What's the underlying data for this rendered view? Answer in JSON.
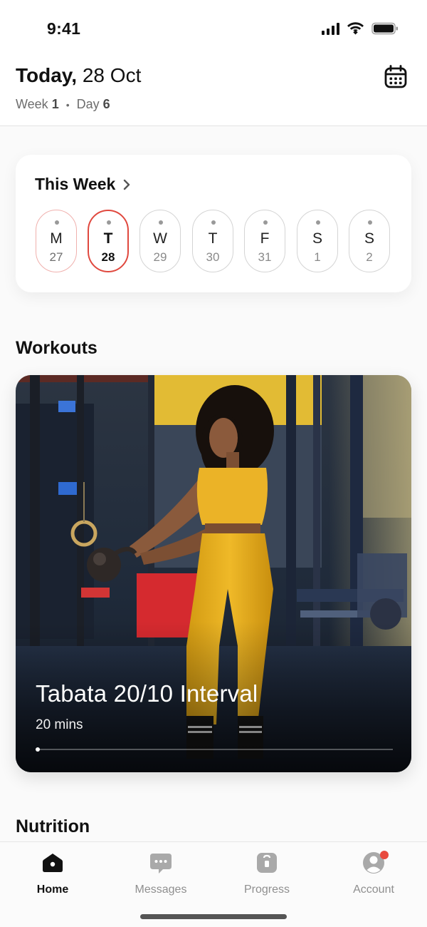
{
  "status_bar": {
    "time": "9:41"
  },
  "header": {
    "title_bold": "Today,",
    "title_date": "28 Oct",
    "week_label": "Week",
    "week_value": "1",
    "separator": "•",
    "day_label": "Day",
    "day_value": "6"
  },
  "this_week": {
    "title": "This Week",
    "days": [
      {
        "letter": "M",
        "date": "27"
      },
      {
        "letter": "T",
        "date": "28"
      },
      {
        "letter": "W",
        "date": "29"
      },
      {
        "letter": "T",
        "date": "30"
      },
      {
        "letter": "F",
        "date": "31"
      },
      {
        "letter": "S",
        "date": "1"
      },
      {
        "letter": "S",
        "date": "2"
      }
    ]
  },
  "workouts": {
    "section_title": "Workouts",
    "card": {
      "name": "Tabata 20/10 Interval",
      "duration": "20 mins",
      "progress": 0
    }
  },
  "nutrition": {
    "section_title": "Nutrition"
  },
  "tab_bar": {
    "tabs": [
      {
        "label": "Home",
        "icon": "home-icon"
      },
      {
        "label": "Messages",
        "icon": "chat-icon"
      },
      {
        "label": "Progress",
        "icon": "progress-icon"
      },
      {
        "label": "Account",
        "icon": "user-icon"
      }
    ]
  },
  "colors": {
    "accent_red": "#e0483e",
    "badge_red": "#e84a3e",
    "outfit_yellow": "#e9b320"
  }
}
